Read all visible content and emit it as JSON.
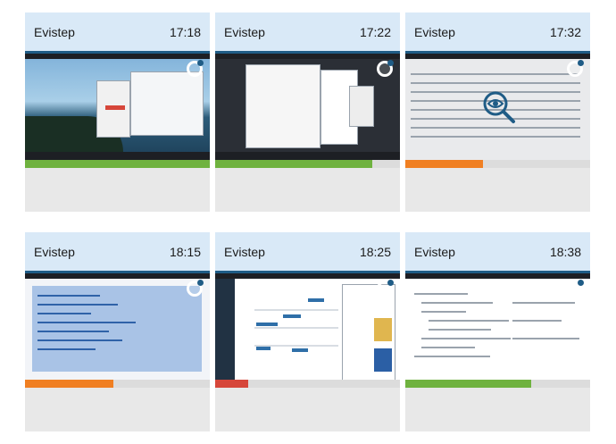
{
  "cards": [
    {
      "name": "Evistep",
      "time": "17:18",
      "progress": 1.0,
      "color": "#6fb23f",
      "theme": "beach"
    },
    {
      "name": "Evistep",
      "time": "17:22",
      "progress": 0.85,
      "color": "#6fb23f",
      "theme": "dark"
    },
    {
      "name": "Evistep",
      "time": "17:32",
      "progress": 0.42,
      "color": "#f07f22",
      "theme": "files"
    },
    {
      "name": "Evistep",
      "time": "18:15",
      "progress": 0.48,
      "color": "#f07f22",
      "theme": "code"
    },
    {
      "name": "Evistep",
      "time": "18:25",
      "progress": 0.18,
      "color": "#d6463a",
      "theme": "calendar"
    },
    {
      "name": "Evistep",
      "time": "18:38",
      "progress": 0.68,
      "color": "#6fb23f",
      "theme": "code2"
    }
  ],
  "icons": {
    "refresh": "refresh-icon",
    "preview": "eye-magnifier-icon"
  }
}
